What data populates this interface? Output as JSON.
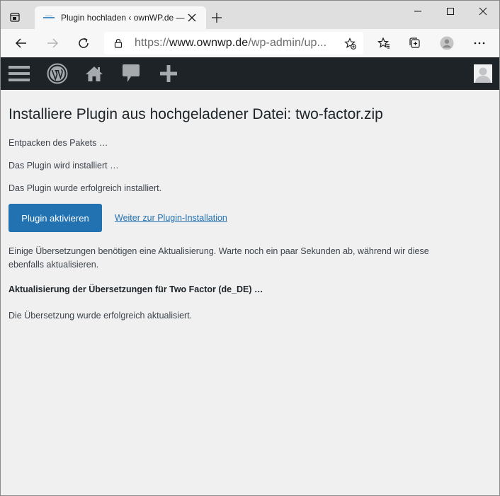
{
  "browser": {
    "tab_title": "Plugin hochladen ‹ ownWP.de — ",
    "url_scheme": "https://",
    "url_host": "www.ownwp.de",
    "url_path": "/wp-admin/up..."
  },
  "page": {
    "title": "Installiere Plugin aus hochgeladener Datei: two-factor.zip",
    "messages": [
      "Entpacken des Pakets …",
      "Das Plugin wird installiert …",
      "Das Plugin wurde erfolgreich installiert."
    ],
    "activate_button": "Plugin aktivieren",
    "continue_link": "Weiter zur Plugin-Installation",
    "translation_notice": "Einige Übersetzungen benötigen eine Aktualisierung. Warte noch ein paar Sekunden ab, während wir diese ebenfalls aktualisieren.",
    "translation_heading": "Aktualisierung der Übersetzungen für Two Factor (de_DE) …",
    "translation_success": "Die Übersetzung wurde erfolgreich aktualisiert."
  },
  "colors": {
    "adminbar": "#1d2327",
    "primary": "#2271b1",
    "background": "#f0f0f1"
  },
  "icons": {
    "adminbar": [
      "menu-icon",
      "wordpress-logo-icon",
      "home-icon",
      "comments-icon",
      "new-content-icon"
    ]
  }
}
